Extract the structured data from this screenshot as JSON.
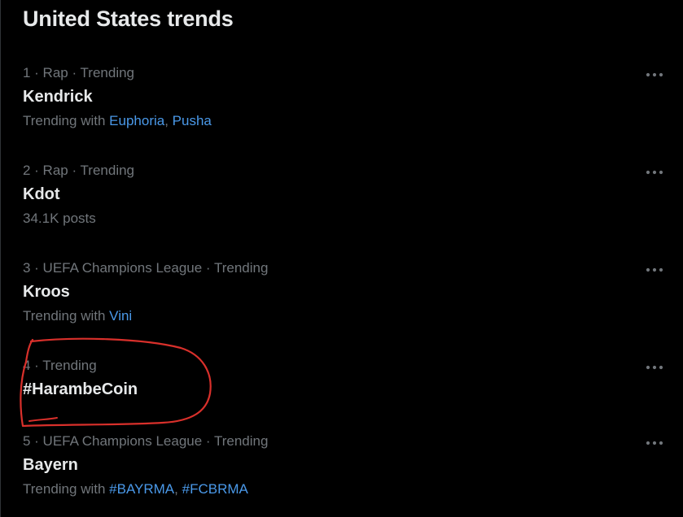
{
  "header": {
    "title": "United States trends"
  },
  "trends": [
    {
      "meta": "1 · Rap · Trending",
      "name": "Kendrick",
      "sub_prefix": "Trending with ",
      "sub_links": [
        "Euphoria",
        "Pusha"
      ],
      "sub_sep": ", "
    },
    {
      "meta": "2 · Rap · Trending",
      "name": "Kdot",
      "sub_text": "34.1K posts"
    },
    {
      "meta": "3 · UEFA Champions League · Trending",
      "name": "Kroos",
      "sub_prefix": "Trending with ",
      "sub_links": [
        "Vini"
      ]
    },
    {
      "meta": "4 · Trending",
      "name": "#HarambeCoin"
    },
    {
      "meta": "5 · UEFA Champions League · Trending",
      "name": "Bayern",
      "sub_prefix": "Trending with ",
      "sub_links": [
        "#BAYRMA",
        "#FCBRMA"
      ],
      "sub_sep": ", "
    }
  ],
  "icons": {
    "more": "more-horizontal-icon"
  },
  "colors": {
    "background": "#000000",
    "primary_text": "#e7e9ea",
    "secondary_text": "#71767b",
    "link": "#4a99e9",
    "annotation": "#d9302b"
  }
}
